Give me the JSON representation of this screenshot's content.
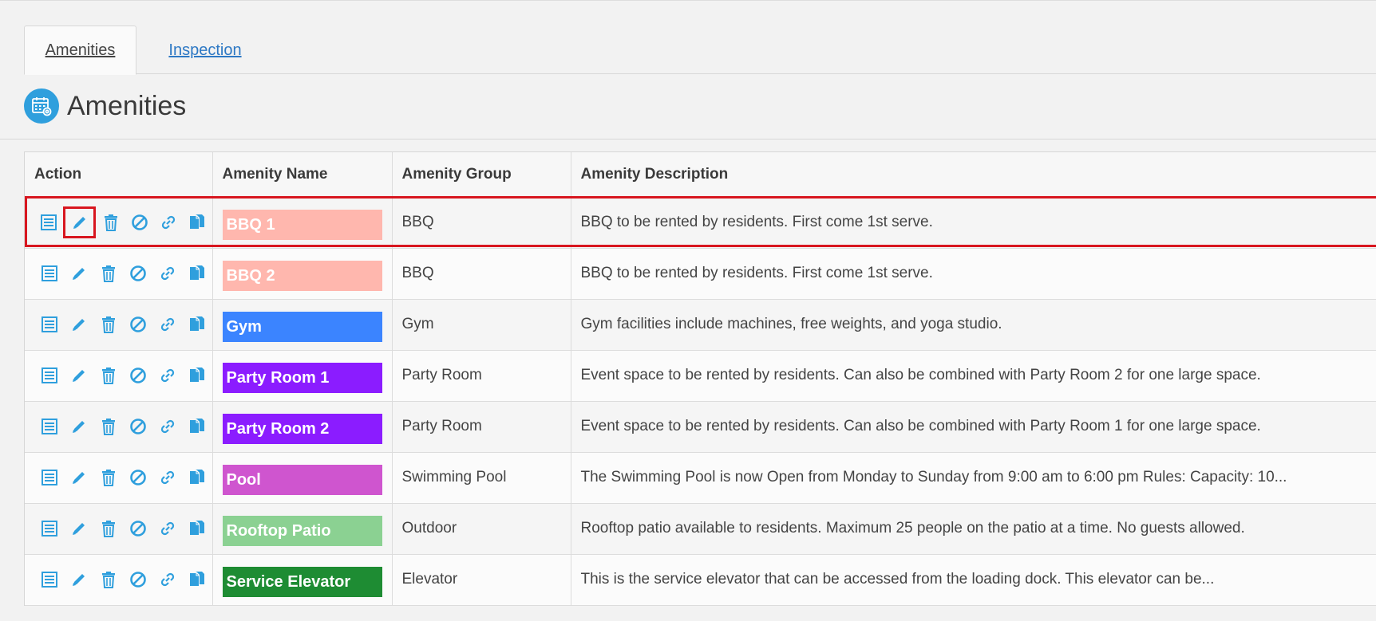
{
  "tabs": [
    {
      "label": "Amenities",
      "active": true
    },
    {
      "label": "Inspection",
      "active": false
    }
  ],
  "page": {
    "title": "Amenities",
    "icon": "calendar-gear-icon",
    "icon_color": "#2f9fdd"
  },
  "table": {
    "headers": {
      "action": "Action",
      "name": "Amenity Name",
      "group": "Amenity Group",
      "description": "Amenity Description"
    },
    "action_icons": [
      "details-list-icon",
      "edit-pencil-icon",
      "delete-trash-icon",
      "disable-ban-icon",
      "link-icon",
      "copy-icon"
    ],
    "action_icon_color": "#2f9fdd",
    "rows": [
      {
        "name": "BBQ 1",
        "color": "#ffb7ae",
        "group": "BBQ",
        "description": "BBQ to be rented by residents. First come 1st serve."
      },
      {
        "name": "BBQ 2",
        "color": "#ffb7ae",
        "group": "BBQ",
        "description": "BBQ to be rented by residents. First come 1st serve."
      },
      {
        "name": "Gym",
        "color": "#3b84ff",
        "group": "Gym",
        "description": "Gym facilities include machines, free weights, and yoga studio."
      },
      {
        "name": "Party Room 1",
        "color": "#8b1cff",
        "group": "Party Room",
        "description": "Event space to be rented by residents. Can also be combined with Party Room 2 for one large space."
      },
      {
        "name": "Party Room 2",
        "color": "#8b1cff",
        "group": "Party Room",
        "description": "Event space to be rented by residents. Can also be combined with Party Room 1 for one large space."
      },
      {
        "name": "Pool",
        "color": "#cf55cf",
        "group": "Swimming Pool",
        "description": "The Swimming Pool is now Open from Monday to Sunday from 9:00 am to 6:00 pm Rules: Capacity: 10..."
      },
      {
        "name": "Rooftop Patio",
        "color": "#8bd192",
        "group": "Outdoor",
        "description": "Rooftop patio available to residents. Maximum 25 people on the patio at a time. No guests allowed."
      },
      {
        "name": "Service Elevator",
        "color": "#1e8c33",
        "group": "Elevator",
        "description": "This is the service elevator that can be accessed from the loading dock. This elevator can be..."
      }
    ]
  },
  "highlight": {
    "row": "BBQ 1",
    "action": "edit-pencil-icon",
    "color": "#d8161f"
  }
}
